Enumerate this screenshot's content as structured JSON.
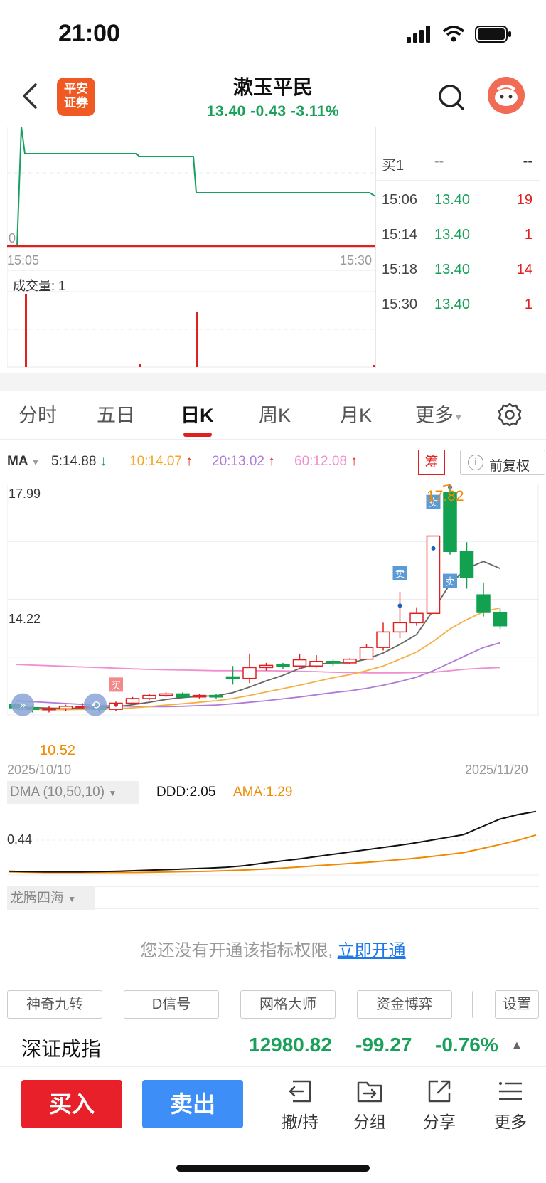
{
  "status_bar": {
    "time": "21:00"
  },
  "header": {
    "logo_line1": "平安",
    "logo_line2": "证券",
    "stock_name": "漱玉平民",
    "quote": "13.40 -0.43 -3.11%"
  },
  "intraday": {
    "zero_label": "0",
    "time_start": "15:05",
    "time_end": "15:30",
    "volume_label": "成交量: 1"
  },
  "tradelist": {
    "buy1_label": "买1",
    "buy1_price": "--",
    "buy1_vol": "--",
    "rows": [
      {
        "time": "15:06",
        "price": "13.40",
        "vol": "19"
      },
      {
        "time": "15:14",
        "price": "13.40",
        "vol": "1"
      },
      {
        "time": "15:18",
        "price": "13.40",
        "vol": "14"
      },
      {
        "time": "15:30",
        "price": "13.40",
        "vol": "1"
      }
    ]
  },
  "tabs": [
    "分时",
    "五日",
    "日K",
    "周K",
    "月K",
    "更多"
  ],
  "ma": {
    "label": "MA",
    "ma5": "5:14.88",
    "ma10": "10:14.07",
    "ma20": "20:13.02",
    "ma60": "60:12.08",
    "badge": "筹",
    "fuquan": "前复权",
    "info_icon_glyph": "i"
  },
  "kline": {
    "price_high_label": "17.99",
    "price_mid_label": "14.22",
    "low_label": "10.52",
    "peak_label": "17.82",
    "date_start": "2025/10/10",
    "date_end": "2025/11/20",
    "buy_marker": "买",
    "sell_marker": "卖",
    "colors": {
      "up": "#e02020",
      "down": "#12a150",
      "ma5": "#666666",
      "ma10": "#f5b041",
      "ma20": "#b07ad8",
      "ma60": "#ef8fcf"
    }
  },
  "dma": {
    "selector": "DMA (10,50,10)",
    "ddd": "DDD:2.05",
    "ama": "AMA:1.29",
    "axis_label": "0.44"
  },
  "indicator2": {
    "selector": "龙腾四海"
  },
  "notice": {
    "text": "您还没有开通该指标权限,",
    "link": "立即开通"
  },
  "tools": [
    "神奇九转",
    "D信号",
    "网格大师",
    "资金博弈",
    "设置"
  ],
  "index_bar": {
    "name": "深证成指",
    "value": "12980.82",
    "change": "-99.27",
    "pct": "-0.76%"
  },
  "bottom": {
    "buy": "买入",
    "sell": "卖出",
    "actions": [
      "撤/持",
      "分组",
      "分享",
      "更多"
    ]
  },
  "chart_data": {
    "type": "candlestick",
    "dates": [
      "2025/10/10",
      "2025/11/20"
    ],
    "ylim": [
      10.52,
      17.99
    ],
    "candles": [
      {
        "o": 10.85,
        "c": 10.75,
        "h": 10.9,
        "l": 10.7
      },
      {
        "o": 10.75,
        "c": 10.7,
        "h": 10.8,
        "l": 10.6
      },
      {
        "o": 10.7,
        "c": 10.72,
        "h": 10.8,
        "l": 10.6
      },
      {
        "o": 10.72,
        "c": 10.8,
        "h": 10.85,
        "l": 10.65
      },
      {
        "o": 10.8,
        "c": 10.8,
        "h": 10.9,
        "l": 10.7
      },
      {
        "o": 10.8,
        "c": 10.7,
        "h": 10.85,
        "l": 10.6
      },
      {
        "o": 10.7,
        "c": 10.9,
        "h": 10.95,
        "l": 10.65
      },
      {
        "o": 10.9,
        "c": 11.05,
        "h": 11.1,
        "l": 10.85
      },
      {
        "o": 11.05,
        "c": 11.15,
        "h": 11.2,
        "l": 11.0
      },
      {
        "o": 11.15,
        "c": 11.2,
        "h": 11.25,
        "l": 11.1
      },
      {
        "o": 11.2,
        "c": 11.1,
        "h": 11.25,
        "l": 11.05
      },
      {
        "o": 11.1,
        "c": 11.15,
        "h": 11.2,
        "l": 11.05
      },
      {
        "o": 11.15,
        "c": 11.1,
        "h": 11.2,
        "l": 11.05
      },
      {
        "o": 11.75,
        "c": 11.7,
        "h": 12.1,
        "l": 11.5
      },
      {
        "o": 11.7,
        "c": 12.05,
        "h": 12.5,
        "l": 11.55
      },
      {
        "o": 12.05,
        "c": 12.12,
        "h": 12.2,
        "l": 11.95
      },
      {
        "o": 12.15,
        "c": 12.1,
        "h": 12.2,
        "l": 12.0
      },
      {
        "o": 12.1,
        "c": 12.3,
        "h": 12.5,
        "l": 12.05
      },
      {
        "o": 12.1,
        "c": 12.25,
        "h": 12.45,
        "l": 12.05
      },
      {
        "o": 12.25,
        "c": 12.2,
        "h": 12.3,
        "l": 12.1
      },
      {
        "o": 12.2,
        "c": 12.32,
        "h": 12.35,
        "l": 12.15
      },
      {
        "o": 12.32,
        "c": 12.7,
        "h": 12.8,
        "l": 12.3
      },
      {
        "o": 12.7,
        "c": 13.2,
        "h": 13.5,
        "l": 12.6
      },
      {
        "o": 13.2,
        "c": 13.5,
        "h": 14.5,
        "l": 13.0
      },
      {
        "o": 13.5,
        "c": 13.8,
        "h": 14.0,
        "l": 13.4
      },
      {
        "o": 13.8,
        "c": 16.3,
        "h": 16.3,
        "l": 13.8
      },
      {
        "o": 17.7,
        "c": 15.8,
        "h": 17.82,
        "l": 15.7
      },
      {
        "o": 15.8,
        "c": 14.95,
        "h": 16.1,
        "l": 14.6
      },
      {
        "o": 14.4,
        "c": 13.83,
        "h": 14.8,
        "l": 13.7
      },
      {
        "o": 13.83,
        "c": 13.4,
        "h": 13.95,
        "l": 13.3
      }
    ],
    "ma5": [
      10.78,
      10.76,
      10.74,
      10.73,
      10.75,
      10.75,
      10.78,
      10.85,
      10.93,
      11.02,
      11.08,
      11.12,
      11.14,
      11.24,
      11.42,
      11.62,
      11.8,
      12.02,
      12.16,
      12.2,
      12.2,
      12.32,
      12.52,
      12.8,
      13.12,
      13.9,
      14.75,
      15.25,
      15.48,
      15.25
    ],
    "ma10": [
      10.7,
      10.7,
      10.69,
      10.69,
      10.7,
      10.71,
      10.72,
      10.75,
      10.79,
      10.84,
      10.88,
      10.93,
      10.98,
      11.05,
      11.15,
      11.26,
      11.37,
      11.48,
      11.6,
      11.72,
      11.82,
      11.95,
      12.1,
      12.32,
      12.55,
      12.9,
      13.3,
      13.6,
      13.85,
      13.98
    ],
    "ma20": [
      10.98,
      10.95,
      10.92,
      10.89,
      10.86,
      10.83,
      10.81,
      10.8,
      10.79,
      10.79,
      10.8,
      10.82,
      10.84,
      10.88,
      10.93,
      10.98,
      11.04,
      11.1,
      11.17,
      11.24,
      11.3,
      11.38,
      11.48,
      11.6,
      11.74,
      11.95,
      12.2,
      12.45,
      12.7,
      12.85
    ],
    "ma60": [
      12.15,
      12.13,
      12.11,
      12.09,
      12.07,
      12.05,
      12.03,
      12.01,
      11.99,
      11.98,
      11.97,
      11.96,
      11.95,
      11.95,
      11.95,
      11.95,
      11.94,
      11.93,
      11.92,
      11.9,
      11.89,
      11.88,
      11.88,
      11.88,
      11.89,
      11.9,
      11.95,
      12.0,
      12.03,
      12.05
    ],
    "dma_ddd": [
      0.12,
      0.11,
      0.1,
      0.1,
      0.1,
      0.11,
      0.12,
      0.14,
      0.16,
      0.18,
      0.2,
      0.22,
      0.25,
      0.3,
      0.38,
      0.45,
      0.52,
      0.6,
      0.68,
      0.76,
      0.84,
      0.92,
      1.0,
      1.1,
      1.2,
      1.3,
      1.55,
      1.8,
      1.95,
      2.05
    ],
    "dma_ama": [
      0.1,
      0.09,
      0.08,
      0.08,
      0.08,
      0.08,
      0.08,
      0.08,
      0.09,
      0.1,
      0.11,
      0.12,
      0.14,
      0.16,
      0.19,
      0.22,
      0.26,
      0.3,
      0.34,
      0.38,
      0.42,
      0.47,
      0.52,
      0.58,
      0.65,
      0.72,
      0.85,
      0.98,
      1.12,
      1.29
    ]
  }
}
